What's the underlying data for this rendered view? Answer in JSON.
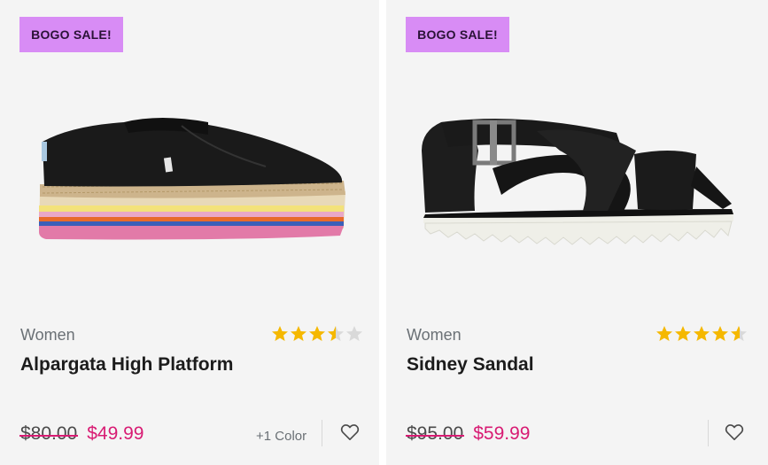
{
  "products": [
    {
      "badge": "BOGO SALE!",
      "image": "alpargata-high-platform-shoe",
      "category": "Women",
      "rating": 3.5,
      "rating_max": 5,
      "name": "Alpargata High Platform",
      "old_price": "$80.00",
      "sale_price": "$49.99",
      "colors": "+1 Color",
      "wishlist_icon": "heart-icon"
    },
    {
      "badge": "BOGO SALE!",
      "image": "sidney-sandal",
      "category": "Women",
      "rating": 4.5,
      "rating_max": 5,
      "name": "Sidney Sandal",
      "old_price": "$95.00",
      "sale_price": "$59.99",
      "wishlist_icon": "heart-icon"
    }
  ],
  "colors": {
    "badge_bg": "#d88cf5",
    "sale_price": "#d81b73",
    "star_filled": "#f5b800",
    "star_empty": "#d9d9d9"
  }
}
